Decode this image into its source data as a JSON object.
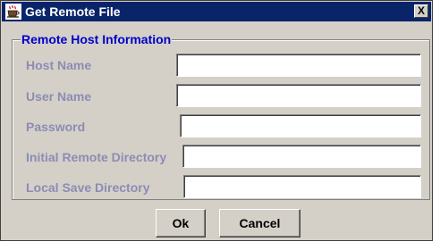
{
  "window": {
    "title": "Get Remote File",
    "icon": "java-coffee-cup-icon",
    "close_label": "X"
  },
  "group": {
    "title": "Remote Host Information"
  },
  "fields": [
    {
      "label": "Host Name",
      "value": ""
    },
    {
      "label": "User Name",
      "value": ""
    },
    {
      "label": "Password",
      "value": ""
    },
    {
      "label": "Initial Remote Directory",
      "value": ""
    },
    {
      "label": "Local Save Directory",
      "value": ""
    }
  ],
  "buttons": {
    "ok_label": "Ok",
    "cancel_label": "Cancel"
  },
  "colors": {
    "titlebar": "#0a246a",
    "group_title": "#0000c8",
    "field_label": "#8c8cb4",
    "dialog_bg": "#d4d0c8"
  }
}
